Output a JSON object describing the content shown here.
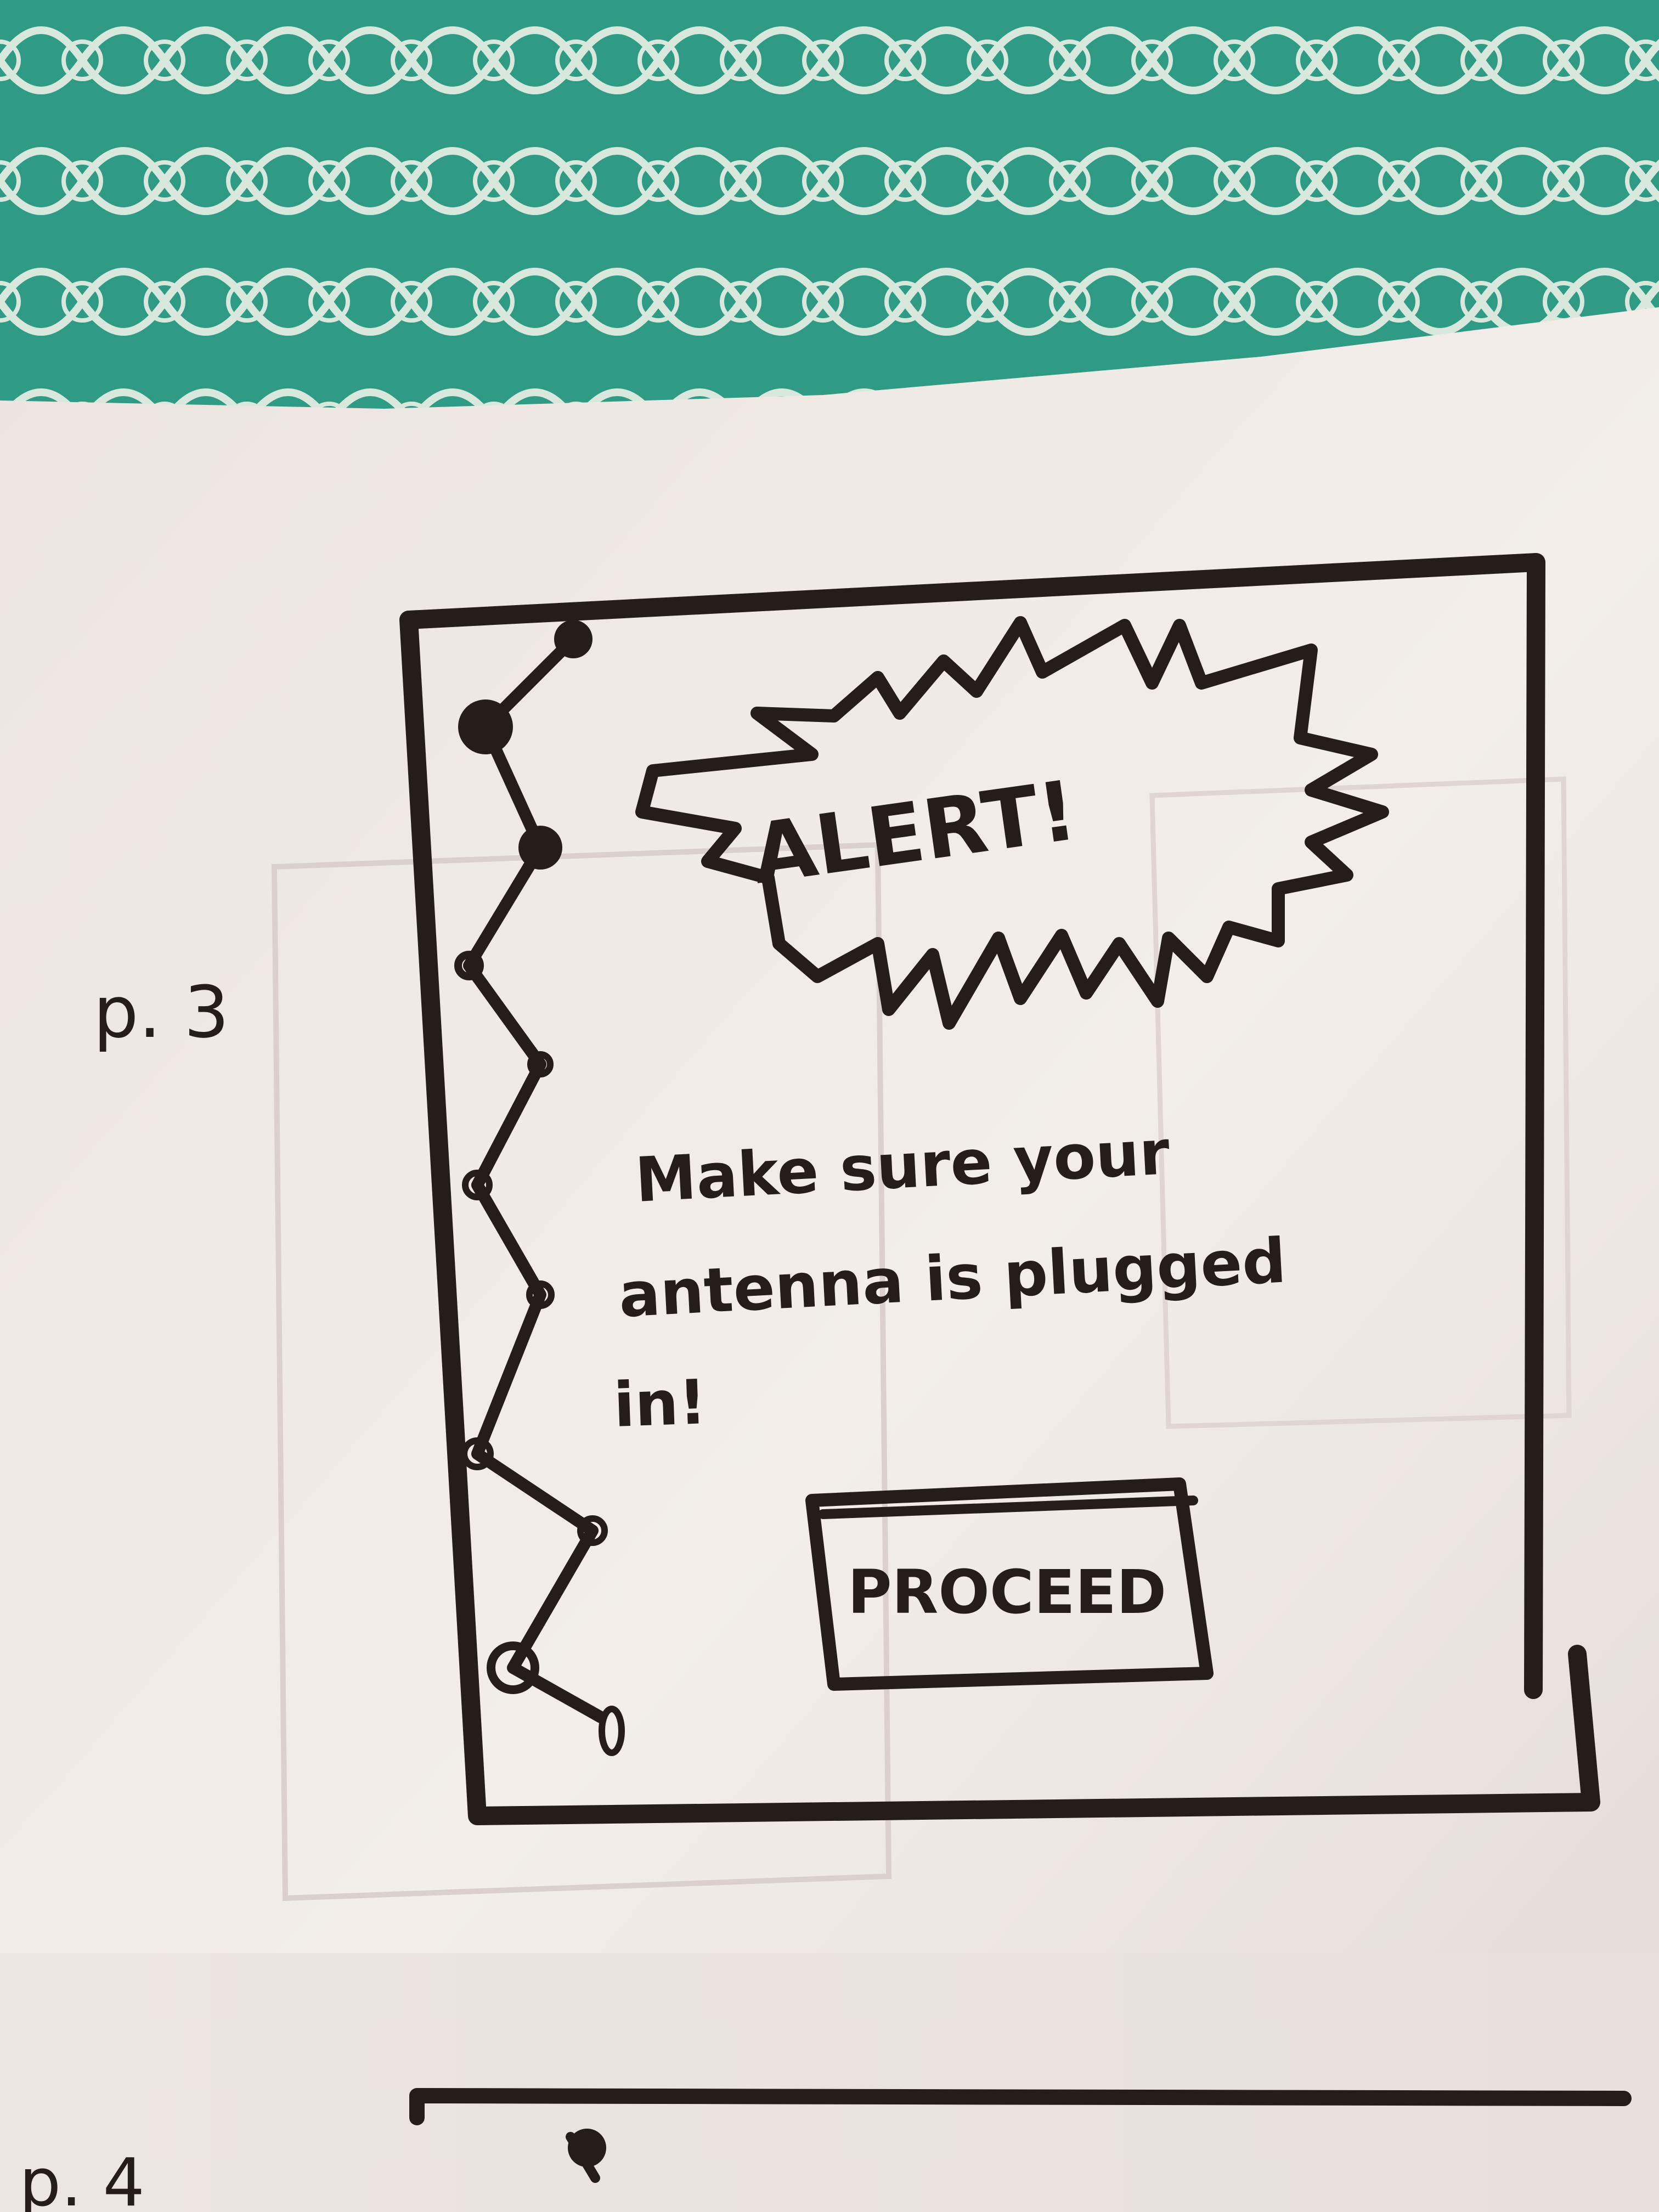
{
  "page_label": "p. 3",
  "next_page_label": "p. 4",
  "alert": {
    "burst_text": "ALERT!"
  },
  "message": {
    "line1": "Make sure your",
    "line2": "antenna is plugged",
    "line3": "in!"
  },
  "proceed_button": {
    "label": "PROCEED"
  },
  "colors": {
    "ink": "#241d19",
    "paper": "#f2ece7",
    "fabric": "#2f9b85",
    "fabric_pattern": "#d9e8dc"
  },
  "icons": {
    "status_path": "connected-nodes-icon"
  }
}
